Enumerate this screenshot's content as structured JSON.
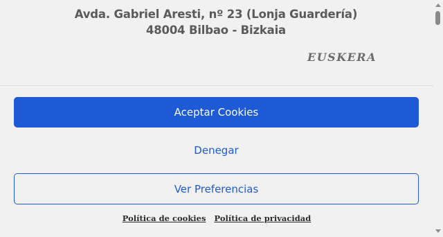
{
  "header": {
    "address": "Avda. Gabriel Aresti, nº 23 (Lonja Guardería) 48004 Bilbao - Bizkaia",
    "language_link": "EUSKERA"
  },
  "consent": {
    "accept_label": "Aceptar Cookies",
    "deny_label": "Denegar",
    "preferences_label": "Ver Preferencias",
    "links": {
      "cookie_policy": "Política de cookies",
      "privacy_policy": "Política de privacidad"
    }
  },
  "colors": {
    "accent": "#1f5ad6",
    "background": "#f1f1f1",
    "text": "#5a5a5a"
  }
}
